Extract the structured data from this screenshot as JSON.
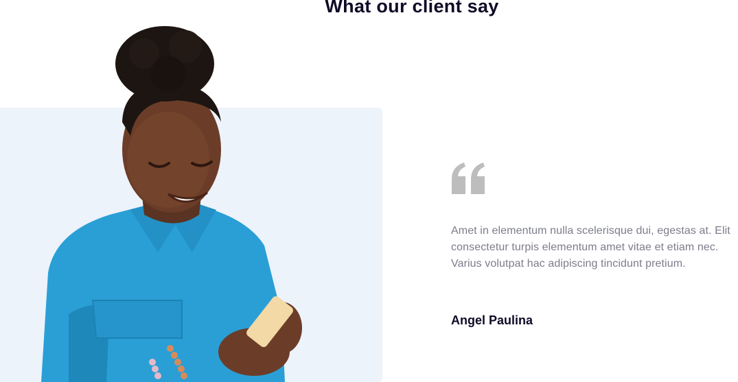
{
  "section": {
    "title": "What our client say"
  },
  "testimonial": {
    "quote_icon": "quote-open-icon",
    "text": "Amet in elementum nulla scelerisque dui, egestas at. Elit consectetur turpis elementum amet vitae et etiam nec. Varius volutpat hac adipiscing tincidunt pretium.",
    "client_name": "Angel Paulina"
  },
  "colors": {
    "heading": "#0f0a26",
    "body_text": "#7b7d8a",
    "panel_bg": "#edf3fa",
    "quote_icon": "#bdbdbd",
    "shirt": "#2a9fd6"
  }
}
